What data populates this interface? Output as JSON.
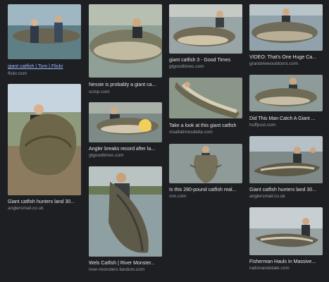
{
  "results": [
    {
      "title": "giant catfish | Tom | Flickr",
      "source": "flickr.com"
    },
    {
      "title": "Nessie is probably a giant ca...",
      "source": "scmp.com"
    },
    {
      "title": "giant catfish 3 - Good Times",
      "source": "gtgoodtimes.com"
    },
    {
      "title": "VIDEO: That's One Huge Ca...",
      "source": "grandviewoutdoors.com"
    },
    {
      "title": "Giant catfish hunters land 30...",
      "source": "anglersmail.co.uk"
    },
    {
      "title": "Angler breaks record after la...",
      "source": "gtgoodtimes.com"
    },
    {
      "title": "Take a look at this giant catfish",
      "source": "visallatimesdelta.com"
    },
    {
      "title": "Did This Man Catch A Giant ...",
      "source": "huffpost.com"
    },
    {
      "title": "Is this 280-pound catfish real...",
      "source": "cnn.com"
    },
    {
      "title": "Giant catfish hunters land 30...",
      "source": "anglersmail.co.uk"
    },
    {
      "title": "Wels Catfish | River Monster...",
      "source": "river-monsters.fandom.com"
    },
    {
      "title": "Fisherman Hauls In Massive...",
      "source": "nationandstate.com"
    }
  ],
  "colors": {
    "background": "#1d1f22",
    "caption": "#e6e6e6",
    "link": "#9db7ff",
    "source": "#9a9ea4"
  }
}
